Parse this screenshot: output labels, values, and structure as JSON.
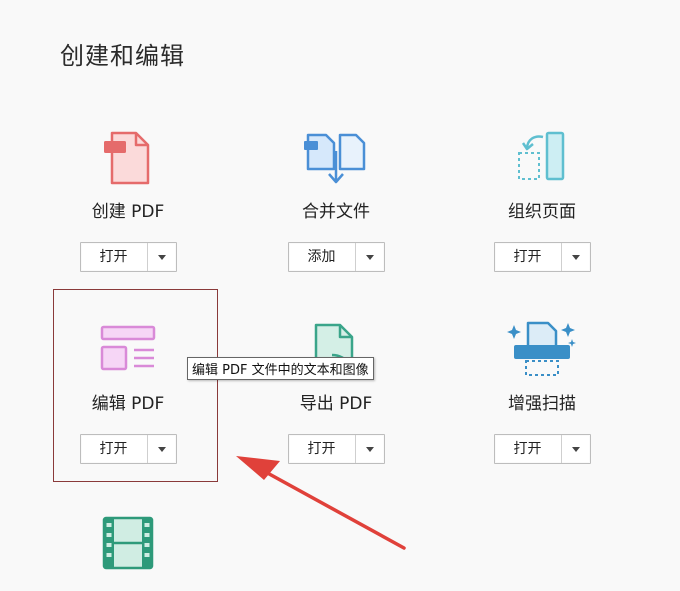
{
  "section": {
    "title": "创建和编辑"
  },
  "tools": [
    {
      "label": "创建 PDF",
      "button": "打开",
      "icon": "create-pdf-icon"
    },
    {
      "label": "合并文件",
      "button": "添加",
      "icon": "combine-files-icon"
    },
    {
      "label": "组织页面",
      "button": "打开",
      "icon": "organize-pages-icon"
    },
    {
      "label": "编辑 PDF",
      "button": "打开",
      "icon": "edit-pdf-icon"
    },
    {
      "label": "导出 PDF",
      "button": "打开",
      "icon": "export-pdf-icon"
    },
    {
      "label": "增强扫描",
      "button": "打开",
      "icon": "enhance-scan-icon"
    },
    {
      "label": "",
      "button": "",
      "icon": "rich-media-icon"
    }
  ],
  "tooltip": {
    "text": "编辑 PDF 文件中的文本和图像"
  },
  "colors": {
    "create": "#e56b6b",
    "combine": "#4a8fd6",
    "organize": "#5fbfd0",
    "edit": "#d98ad8",
    "export": "#3aa58a",
    "scan": "#3a8fc7",
    "media": "#2e9a7a",
    "arrow": "#e0413a",
    "highlight": "#8a3a3a"
  }
}
